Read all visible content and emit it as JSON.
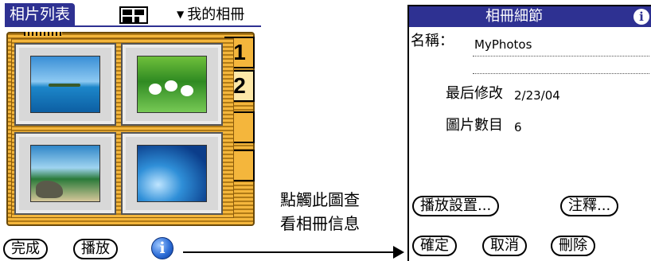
{
  "left_screen": {
    "title": "相片列表",
    "album_select": {
      "value": "我的相冊"
    },
    "page_tabs": [
      "1",
      "2",
      "",
      ""
    ],
    "active_tab": "2",
    "buttons": {
      "done": "完成",
      "play": "播放"
    },
    "icons": {
      "view_toggle": "grid-view-icon",
      "info": "info-icon"
    }
  },
  "annotation": {
    "lines": [
      "點觸此圖查",
      "看相冊信息"
    ]
  },
  "right_screen": {
    "dialog_title": "相冊細節",
    "name_label": "名稱：",
    "name_value": "MyPhotos",
    "modified_label": "最后修改",
    "modified_value": "2/23/04",
    "count_label": "圖片數目",
    "count_value": "6",
    "buttons": {
      "play_settings": "播放設置...",
      "notes": "注釋...",
      "ok": "確定",
      "cancel": "取消",
      "delete": "刪除"
    }
  },
  "colors": {
    "title_bar": "#2e3192",
    "album_wood": "#f4b63c",
    "album_wood_dark": "#b07a16"
  }
}
